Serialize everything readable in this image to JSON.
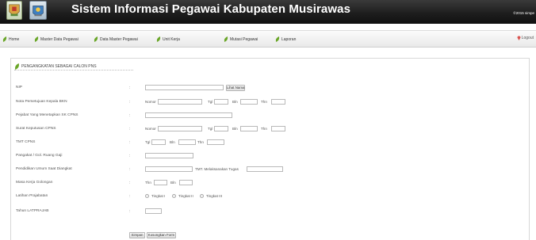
{
  "header": {
    "title": "Sistem Informasi Pegawai Kabupaten Musirawas",
    "copyright": "©2015 simpe"
  },
  "nav": {
    "items": [
      {
        "label": "Home"
      },
      {
        "label": "Master Data Pegawai"
      },
      {
        "label": "Data Master Pegawai"
      },
      {
        "label": "Unit Kerja"
      },
      {
        "label": "Mutasi Pegawai"
      },
      {
        "label": "Laporan"
      }
    ],
    "logout": "Logout"
  },
  "form": {
    "section_title": "PENGANGKATAN SEBAGAI CALON PNS",
    "fields": {
      "nip": "NIP",
      "nota_bkn": "Nota Persetujuan Kepala BKN",
      "pejabat": "Pejabat Yang Menetapkan SK CPNS",
      "sk_cpns": "Surat Keputusan CPNS",
      "tmt_cpns": "TMT CPNS",
      "pangkat": "Pangakat / Gol. Ruang Gaji",
      "pendidikan": "Pendidikan Umum Saat Diangkat",
      "masa_kerja": "Masa Kerja Golongan",
      "latihan": "Latihan Prajabatan",
      "tahun_latprajab": "Tahun LATPRAJAB"
    },
    "colon": ":",
    "lihat_nama": "Lihat Nama",
    "nomor": "Nomor",
    "tgl": "Tgl",
    "bln": "Bln",
    "thn": "Thn",
    "tmt_tugas": "TMT. Melaksanakan Tugas",
    "tingkat": [
      "Tingkat I",
      "Tingkat II",
      "Tingkat III"
    ],
    "buttons": {
      "simpan": "Simpan",
      "kosongkan": "Kosongkan Form"
    }
  }
}
